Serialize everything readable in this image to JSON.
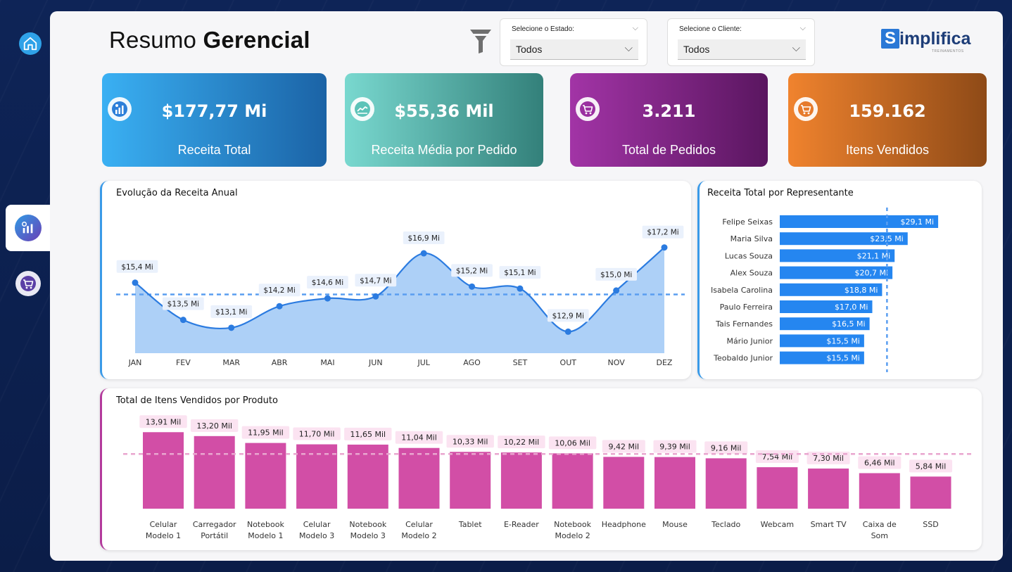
{
  "dashboard": {
    "title_light": "Resumo",
    "title_bold": "Gerencial"
  },
  "filters": {
    "state": {
      "label": "Selecione o Estado:",
      "value": "Todos"
    },
    "client": {
      "label": "Selecione o Cliente:",
      "value": "Todos"
    }
  },
  "logo": {
    "letter": "S",
    "word": "implifica",
    "sub": "TREINAMENTOS"
  },
  "nav": {
    "items": [
      "home-icon",
      "revenue-icon",
      "cart-icon"
    ],
    "active": "revenue-icon"
  },
  "kpis": [
    {
      "value": "$177,77 Mi",
      "label": "Receita Total",
      "icon": "revenue-chart-icon",
      "gradient": [
        "#3ab0f3",
        "#1b63a6"
      ]
    },
    {
      "value": "$55,36 Mil",
      "label": "Receita Média por Pedido",
      "icon": "handshake-icon",
      "gradient": [
        "#79d8cf",
        "#33807a"
      ]
    },
    {
      "value": "3.211",
      "label": "Total de Pedidos",
      "icon": "cart-icon",
      "gradient": [
        "#a234a6",
        "#5a1660"
      ]
    },
    {
      "value": "159.162",
      "label": "Itens Vendidos",
      "icon": "cart-icon",
      "gradient": [
        "#f0832e",
        "#8e4a17"
      ]
    }
  ],
  "colors": {
    "line": "#2b7be0",
    "area": "#a9cdf7",
    "bar_blue": "#2586f0",
    "bar_pink": "#d24ea6",
    "avg_line_blue": "#5a9ef0",
    "avg_line_pink": "#e9a6cf"
  },
  "chart_data": [
    {
      "type": "area",
      "title": "Evolução da Receita Anual",
      "categories": [
        "JAN",
        "FEV",
        "MAR",
        "ABR",
        "MAI",
        "JUN",
        "JUL",
        "AGO",
        "SET",
        "OUT",
        "NOV",
        "DEZ"
      ],
      "values": [
        15.4,
        13.5,
        13.1,
        14.2,
        14.6,
        14.7,
        16.9,
        15.2,
        15.1,
        12.9,
        15.0,
        17.2
      ],
      "data_labels": [
        "$15,4 Mi",
        "$13,5 Mi",
        "$13,1 Mi",
        "$14,2 Mi",
        "$14,6 Mi",
        "$14,7 Mi",
        "$16,9 Mi",
        "$15,2 Mi",
        "$15,1 Mi",
        "$12,9 Mi",
        "$15,0 Mi",
        "$17,2 Mi"
      ],
      "average_line": 14.8,
      "ylim": [
        11.8,
        17.8
      ],
      "grid": false
    },
    {
      "type": "bar",
      "orientation": "horizontal",
      "title": "Receita Total por Representante",
      "categories": [
        "Felipe Seixas",
        "Maria Silva",
        "Lucas Souza",
        "Alex Souza",
        "Isabela Carolina",
        "Paulo Ferreira",
        "Tais Fernandes",
        "Mário Junior",
        "Teobaldo Junior"
      ],
      "values": [
        29.1,
        23.5,
        21.1,
        20.7,
        18.8,
        17.0,
        16.5,
        15.5,
        15.5
      ],
      "data_labels": [
        "$29,1 Mi",
        "$23,5 Mi",
        "$21,1 Mi",
        "$20,7 Mi",
        "$18,8 Mi",
        "$17,0 Mi",
        "$16,5 Mi",
        "$15,5 Mi",
        "$15,5 Mi"
      ],
      "average_line": 19.7,
      "xlim": [
        0,
        30.9
      ],
      "grid": false
    },
    {
      "type": "bar",
      "title": "Total de Itens Vendidos por Produto",
      "categories": [
        "Celular Modelo 1",
        "Carregador Portátil",
        "Notebook Modelo 1",
        "Celular Modelo 3",
        "Notebook Modelo 3",
        "Celular Modelo 2",
        "Tablet",
        "E-Reader",
        "Notebook Modelo 2",
        "Headphone",
        "Mouse",
        "Teclado",
        "Webcam",
        "Smart TV",
        "Caixa de Som",
        "SSD"
      ],
      "category_lines": [
        [
          "Celular",
          "Modelo 1"
        ],
        [
          "Carregador",
          "Portátil"
        ],
        [
          "Notebook",
          "Modelo 1"
        ],
        [
          "Celular",
          "Modelo 3"
        ],
        [
          "Notebook",
          "Modelo 3"
        ],
        [
          "Celular",
          "Modelo 2"
        ],
        [
          "Tablet"
        ],
        [
          "E-Reader"
        ],
        [
          "Notebook",
          "Modelo 2"
        ],
        [
          "Headphone"
        ],
        [
          "Mouse"
        ],
        [
          "Teclado"
        ],
        [
          "Webcam"
        ],
        [
          "Smart TV"
        ],
        [
          "Caixa de",
          "Som"
        ],
        [
          "SSD"
        ]
      ],
      "values": [
        13.91,
        13.2,
        11.95,
        11.7,
        11.65,
        11.04,
        10.33,
        10.22,
        10.06,
        9.42,
        9.39,
        9.16,
        7.54,
        7.3,
        6.46,
        5.84
      ],
      "data_labels": [
        "13,91 Mil",
        "13,20 Mil",
        "11,95 Mil",
        "11,70 Mil",
        "11,65 Mil",
        "11,04 Mil",
        "10,33 Mil",
        "10,22 Mil",
        "10,06 Mil",
        "9,42 Mil",
        "9,39 Mil",
        "9,16 Mil",
        "7,54 Mil",
        "7,30 Mil",
        "6,46 Mil",
        "5,84 Mil"
      ],
      "average_line": 9.95,
      "ylim": [
        0,
        14.2
      ],
      "grid": false
    }
  ]
}
